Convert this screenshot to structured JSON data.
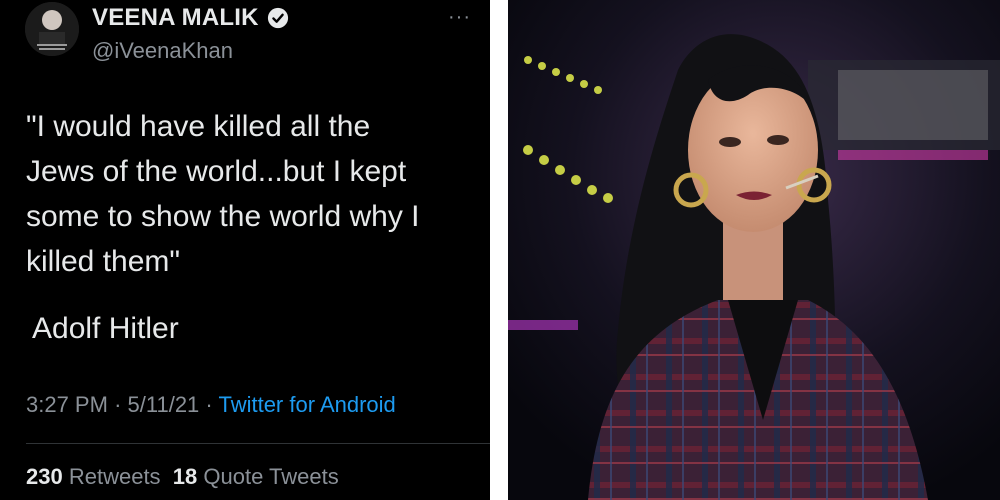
{
  "tweet": {
    "display_name": "VEENA MALIK",
    "handle": "@iVeenaKhan",
    "text": "\"I would have killed all the\nJews of the world...but I kept\nsome to show the world why I\nkilled them\"",
    "attribution": "Adolf Hitler",
    "time": "3:27 PM",
    "date": "5/11/21",
    "separator": "·",
    "source": "Twitter for Android",
    "retweets_count": "230",
    "retweets_label": "Retweets",
    "quote_count": "18",
    "quote_label": "Quote Tweets",
    "more_glyph": "···"
  },
  "icons": {
    "verified": "verified-badge-icon",
    "more": "more-options-icon"
  },
  "colors": {
    "background": "#000000",
    "primary_text": "#e7e9ea",
    "secondary_text": "#8b9198",
    "link": "#1d9bf0"
  }
}
